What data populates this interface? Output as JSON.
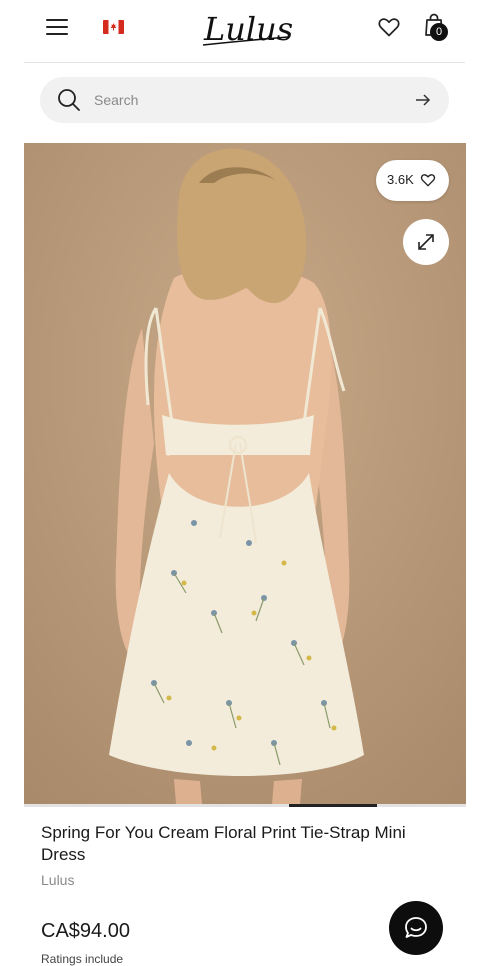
{
  "header": {
    "menu_icon": "hamburger-icon",
    "flag_icon": "canada-flag-icon",
    "logo_text": "Lulus",
    "wishlist_icon": "heart-icon",
    "cart_icon": "shopping-bag-icon",
    "cart_count": "0"
  },
  "search": {
    "placeholder": "Search",
    "icon": "search-icon",
    "submit_icon": "arrow-right-icon"
  },
  "product": {
    "favorite_count": "3.6K",
    "favorite_icon": "heart-icon",
    "expand_icon": "expand-icon",
    "title": "Spring For You Cream Floral Print Tie-Strap Mini Dress",
    "brand": "Lulus",
    "price": "CA$94.00",
    "ratings_text": "Ratings include"
  },
  "colors": {
    "image_background": "#b99a7b",
    "dress": "#f3ecda",
    "text": "#1a1a1a",
    "muted": "#8a8a8a"
  },
  "chat": {
    "icon": "chat-bubble-icon"
  }
}
